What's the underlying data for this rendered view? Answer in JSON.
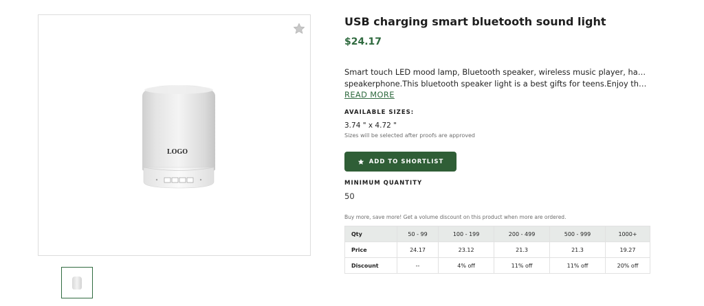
{
  "product": {
    "title": "USB charging smart bluetooth sound light",
    "price": "$24.17",
    "description_line1": "Smart touch LED mood lamp, Bluetooth speaker, wireless music player, hands-free",
    "description_line2": "speakerphone.This bluetooth speaker light is a best gifts for teens.Enjoy the warm…",
    "read_more": "READ MORE",
    "image_logo_text": "LOGO"
  },
  "sizes": {
    "label": "AVAILABLE SIZES:",
    "value": "3.74 \" x 4.72 \"",
    "note": "Sizes will be selected after proofs are approved"
  },
  "shortlist": {
    "label": "ADD TO SHORTLIST",
    "icon": "star-icon"
  },
  "minimum_quantity": {
    "label": "MINIMUM QUANTITY",
    "value": "50"
  },
  "volume": {
    "note": "Buy more, save more! Get a volume discount on this product when more are ordered.",
    "header": [
      "Qty",
      "50 - 99",
      "100 - 199",
      "200 - 499",
      "500 - 999",
      "1000+"
    ],
    "price_row": [
      "Price",
      "24.17",
      "23.12",
      "21.3",
      "21.3",
      "19.27"
    ],
    "discount_row": [
      "Discount",
      "--",
      "4% off",
      "11% off",
      "11% off",
      "20% off"
    ]
  },
  "colors": {
    "accent": "#2f6a3f",
    "button": "#2f5e36",
    "table_header": "#e7eae8"
  }
}
